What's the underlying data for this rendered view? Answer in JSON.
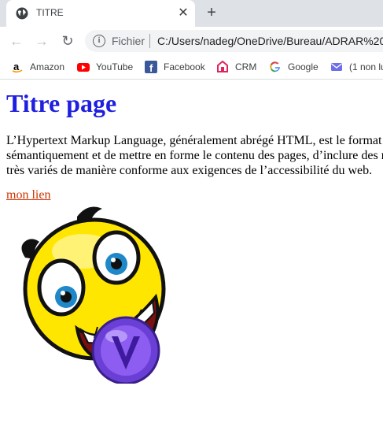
{
  "tab": {
    "title": "TITRE",
    "close_label": "✕",
    "new_tab_label": "+"
  },
  "toolbar": {
    "back": "←",
    "forward": "→",
    "reload": "↻",
    "info": "i",
    "scheme": "Fichier",
    "url": "C:/Users/nadeg/OneDrive/Bureau/ADRAR%20S"
  },
  "bookmarks": [
    {
      "label": "Amazon",
      "icon": "amazon-icon"
    },
    {
      "label": "YouTube",
      "icon": "youtube-icon"
    },
    {
      "label": "Facebook",
      "icon": "facebook-icon"
    },
    {
      "label": "CRM",
      "icon": "crm-icon"
    },
    {
      "label": "Google",
      "icon": "google-icon"
    },
    {
      "label": "(1 non lu",
      "icon": "mail-icon"
    }
  ],
  "page": {
    "heading": "Titre page",
    "paragraph_lines": [
      "L’Hypertext Markup Language, généralement abrégé HTML, est le format",
      "sémantiquement et de mettre en forme le contenu des pages, d’inclure des r",
      "très variés de manière conforme aux exigences de l’accessibilité du web."
    ],
    "link": "mon lien"
  },
  "colors": {
    "heading": "#1f1fe0",
    "link": "#cc3300"
  }
}
